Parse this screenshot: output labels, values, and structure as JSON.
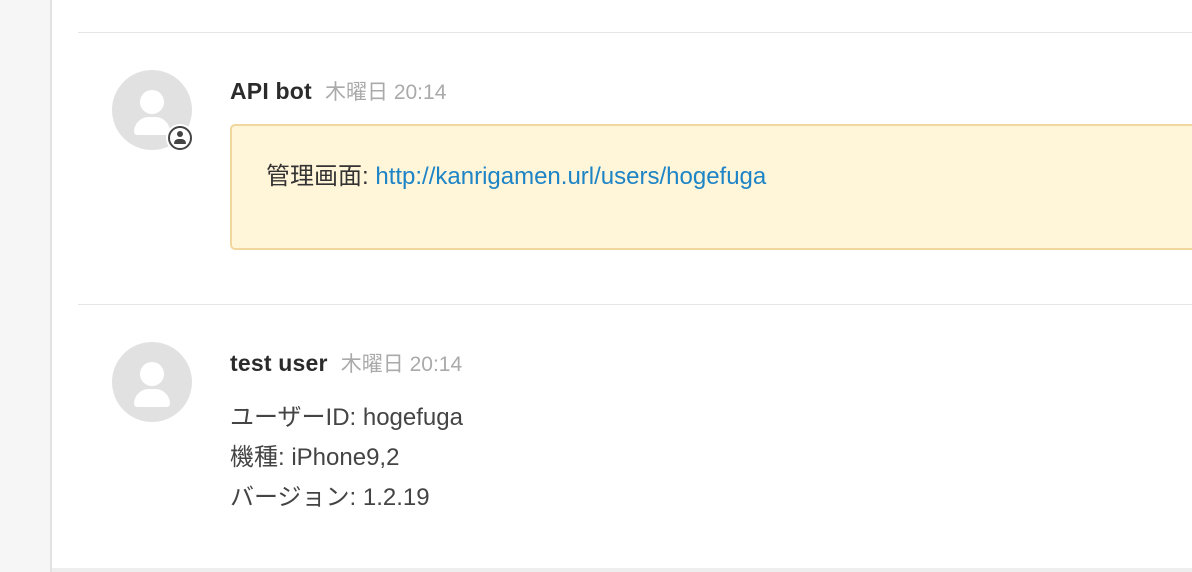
{
  "messages": [
    {
      "author": "API bot",
      "timestamp": "木曜日 20:14",
      "is_bot": true,
      "attachment": {
        "label": "管理画面: ",
        "link_text": "http://kanrigamen.url/users/hogefuga",
        "background_color": "#fff5d9",
        "border_color": "#f1d79d",
        "link_color": "#1d84c6"
      }
    },
    {
      "author": "test user",
      "timestamp": "木曜日 20:14",
      "is_bot": false,
      "lines": [
        "ユーザーID: hogefuga",
        "機種: iPhone9,2",
        "バージョン: 1.2.19"
      ]
    }
  ],
  "icons": {
    "avatar": "user-avatar-icon",
    "bot_badge": "bot-badge-icon"
  }
}
